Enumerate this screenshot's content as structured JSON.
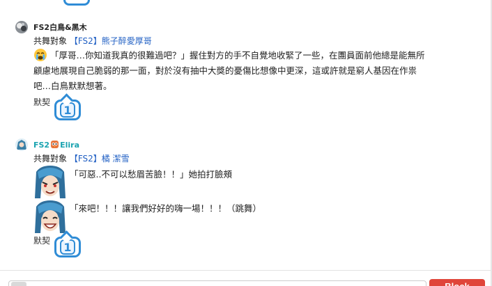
{
  "posts": [
    {
      "author": "FS2白鳥&黑木",
      "target_prefix": "共舞對象",
      "target_name": "【FS2】熊子醉愛厚哥",
      "message_lines": [
        "「厚哥…你知道我真的很難過吧？」握住對方的手不自覺地收緊了一些，在團員面前他總是能無所",
        "顧慮地展現自己脆弱的那一面，對於沒有抽中大獎的憂傷比想像中更深，這或許就是窮人基因在作祟",
        "吧…白鳥默默想著。"
      ],
      "reaction_label": "默契",
      "reaction_count": "1"
    },
    {
      "author_prefix": "FS2",
      "author_suffix": "Elira",
      "target_prefix": "共舞對象",
      "target_name": "【FS2】橘 潔雪",
      "sticker_lines": [
        "「可惡..不可以愁眉苦臉！！」她拍打臉頰",
        "「來吧！！！讓我們好好的嗨一場！！！（跳舞）"
      ],
      "reaction_label": "默契",
      "reaction_count": "1"
    }
  ],
  "compose": {
    "block_label": "Block"
  },
  "colors": {
    "link": "#2160c4",
    "badge": "#2f8cd6",
    "block_button": "#e0453a",
    "elira_name": "#1aa3b0"
  },
  "icons": {
    "crying_emoji": "crying-face-icon",
    "owl_emoji": "owl-icon"
  }
}
